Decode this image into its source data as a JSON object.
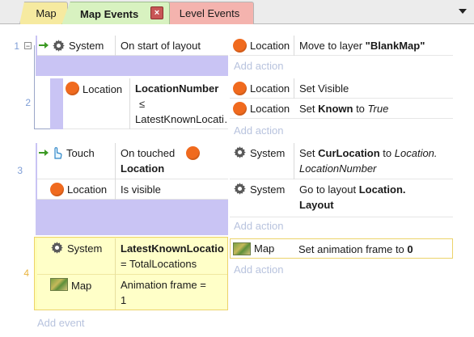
{
  "tabs": [
    {
      "label": "Map"
    },
    {
      "label": "Map Events"
    },
    {
      "label": "Level Events"
    }
  ],
  "close_glyph": "×",
  "events": [
    {
      "number": "1",
      "conditions": [
        {
          "object": "System",
          "icon": "gear-icon",
          "text": "On start of layout"
        }
      ],
      "actions": [
        {
          "object": "Location",
          "icon": "location-dot-icon",
          "text_a": "Move to layer ",
          "bold": "\"BlankMap\""
        }
      ],
      "add_action": "Add action"
    },
    {
      "number": "2",
      "conditions": [
        {
          "object": "Location",
          "icon": "location-dot-icon",
          "line1": "LocationNumber",
          "line2": "≤",
          "line3": "LatestKnownLocati…"
        }
      ],
      "actions": [
        {
          "object": "Location",
          "icon": "location-dot-icon",
          "text": "Set Visible"
        },
        {
          "object": "Location",
          "icon": "location-dot-icon",
          "text_a": "Set ",
          "bold": "Known",
          "text_b": " to ",
          "italic": "True"
        }
      ],
      "add_action": "Add action"
    },
    {
      "number": "3",
      "conditions": [
        {
          "object": "Touch",
          "icon": "touch-hand-icon",
          "text_a": "On touched",
          "bold": "Location"
        },
        {
          "object": "Location",
          "icon": "location-dot-icon",
          "text": "Is visible"
        }
      ],
      "actions": [
        {
          "object": "System",
          "icon": "gear-icon",
          "text_a": "Set ",
          "bold": "CurLocation",
          "text_b": " to ",
          "italic": "Location.",
          "italic2": "LocationNumber"
        },
        {
          "object": "System",
          "icon": "gear-icon",
          "text_a": "Go to layout ",
          "bold": "Location.",
          "bold2": "Layout"
        }
      ],
      "add_action": "Add action"
    },
    {
      "number": "4",
      "conditions": [
        {
          "object": "System",
          "icon": "gear-icon",
          "bold": "LatestKnownLocatio",
          "text": " = TotalLocations"
        },
        {
          "object": "Map",
          "icon": "map-tile-icon",
          "text": "Animation frame =",
          "text2": "1"
        }
      ],
      "actions": [
        {
          "object": "Map",
          "icon": "map-tile-icon",
          "text_a": "Set animation frame to ",
          "bold": "0"
        }
      ],
      "add_action": "Add action"
    }
  ],
  "add_event": "Add event",
  "colors": {
    "condition_bar": "#c9c4f4",
    "selected_bar": "#ffffb7",
    "location_dot": "#f06a1e",
    "event_number": "#7f9ed6",
    "selected_number": "#e9b43f"
  }
}
